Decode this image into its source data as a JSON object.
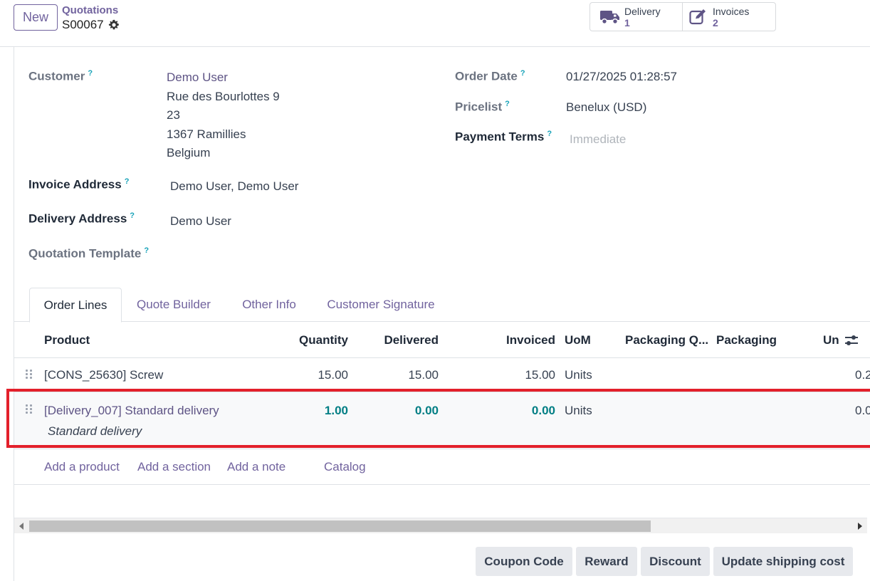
{
  "topbar": {
    "new_label": "New",
    "breadcrumb_parent": "Quotations",
    "record_name": "S00067"
  },
  "smart_buttons": [
    {
      "label": "Delivery",
      "value": "1",
      "icon": "truck-icon"
    },
    {
      "label": "Invoices",
      "value": "2",
      "icon": "edit-icon"
    }
  ],
  "form": {
    "customer_label": "Customer",
    "customer_name": "Demo User",
    "customer_address": [
      "Rue des Bourlottes 9",
      "23",
      "1367 Ramillies",
      "Belgium"
    ],
    "invoice_address_label": "Invoice Address",
    "invoice_address": "Demo User, Demo User",
    "delivery_address_label": "Delivery Address",
    "delivery_address": "Demo User",
    "quotation_template_label": "Quotation Template",
    "order_date_label": "Order Date",
    "order_date": "01/27/2025 01:28:57",
    "pricelist_label": "Pricelist",
    "pricelist": "Benelux (USD)",
    "payment_terms_label": "Payment Terms",
    "payment_terms_placeholder": "Immediate",
    "help_mark": "?"
  },
  "tabs": [
    "Order Lines",
    "Quote Builder",
    "Other Info",
    "Customer Signature"
  ],
  "table": {
    "columns": [
      "Product",
      "Quantity",
      "Delivered",
      "Invoiced",
      "UoM",
      "Packaging Q...",
      "Packaging",
      "Un"
    ],
    "rows": [
      {
        "product": "[CONS_25630] Screw",
        "quantity": "15.00",
        "delivered": "15.00",
        "invoiced": "15.00",
        "uom": "Units",
        "unit_price": "0.2"
      },
      {
        "product": "[Delivery_007] Standard delivery",
        "description": "Standard delivery",
        "quantity": "1.00",
        "delivered": "0.00",
        "invoiced": "0.00",
        "uom": "Units",
        "unit_price": "0.0"
      }
    ],
    "add_links": [
      "Add a product",
      "Add a section",
      "Add a note",
      "Catalog"
    ]
  },
  "footer_buttons": [
    "Coupon Code",
    "Reward",
    "Discount",
    "Update shipping cost"
  ],
  "colors": {
    "brand": "#71639e",
    "highlight_border": "#e3202b",
    "changed_value": "#017e84"
  }
}
